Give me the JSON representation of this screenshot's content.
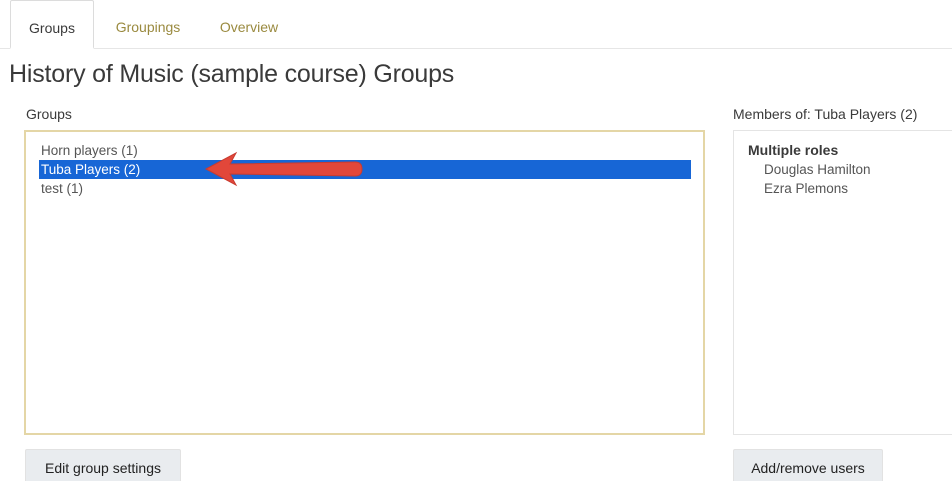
{
  "tabs": [
    {
      "label": "Groups",
      "active": true
    },
    {
      "label": "Groupings",
      "active": false
    },
    {
      "label": "Overview",
      "active": false
    }
  ],
  "page_title": "History of Music (sample course) Groups",
  "groups_panel": {
    "label": "Groups",
    "options": [
      {
        "label": "Horn players (1)",
        "selected": false
      },
      {
        "label": "Tuba Players (2)",
        "selected": true
      },
      {
        "label": "test (1)",
        "selected": false
      }
    ]
  },
  "members_panel": {
    "label": "Members of: Tuba Players (2)",
    "role_heading": "Multiple roles",
    "members": [
      "Douglas Hamilton",
      "Ezra Plemons"
    ]
  },
  "buttons": {
    "edit_group_settings": "Edit group settings",
    "add_remove_users": "Add/remove users"
  },
  "colors": {
    "selection": "#1766d6",
    "tab_link": "#9a8a3f",
    "annotation_arrow": "#e2473a",
    "focus_border": "#e4d6a6"
  },
  "icons": {
    "annotation": "red-arrow-icon"
  }
}
